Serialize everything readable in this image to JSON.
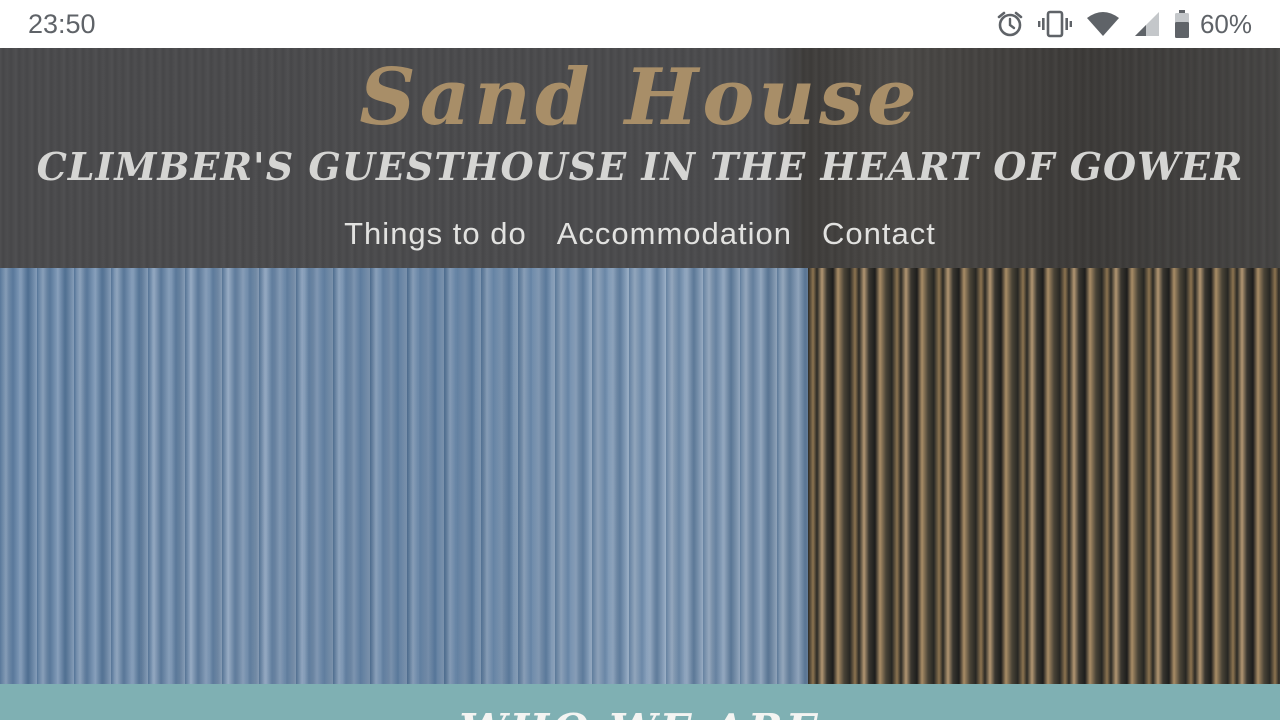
{
  "status_bar": {
    "time": "23:50",
    "icons": [
      "alarm-icon",
      "vibrate-icon",
      "wifi-icon",
      "cell-signal-icon",
      "battery-icon"
    ],
    "battery_percent": "60%"
  },
  "header": {
    "site_title": "Sand House",
    "tagline": "CLIMBER'S GUESTHOUSE IN THE HEART OF GOWER",
    "nav": [
      {
        "label": "Things to do"
      },
      {
        "label": "Accommodation"
      },
      {
        "label": "Contact"
      }
    ]
  },
  "next_section": {
    "heading": "WHO WE ARE"
  },
  "colors": {
    "title_gold": "#a88e68",
    "tagline": "#d5d5d3",
    "header_bg": "#4a4a4c",
    "section_teal": "#7fb0b3"
  }
}
